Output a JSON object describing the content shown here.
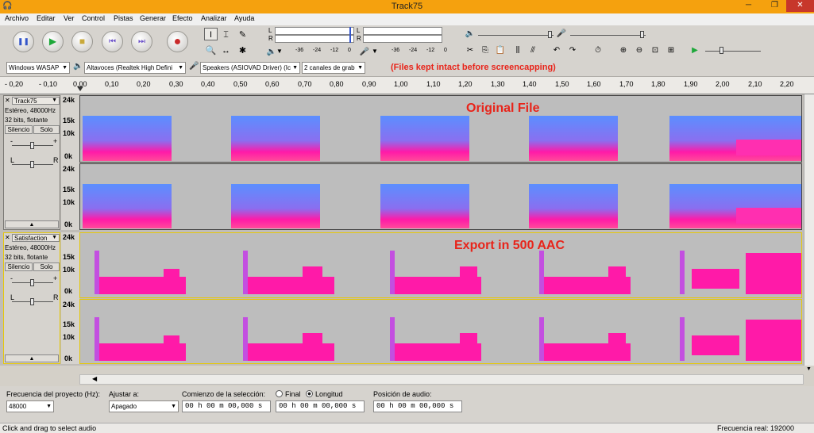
{
  "window": {
    "title": "Track75",
    "min": "─",
    "max": "❐",
    "close": "✕"
  },
  "menu": [
    "Archivo",
    "Editar",
    "Ver",
    "Control",
    "Pistas",
    "Generar",
    "Efecto",
    "Analizar",
    "Ayuda"
  ],
  "transport": {
    "pause": "❚❚",
    "play": "▶",
    "stop": "■",
    "skip_start": "⏮",
    "skip_end": "⏭",
    "record": "●"
  },
  "meters": {
    "rec_scale": [
      "-36",
      "-24",
      "-12",
      "0"
    ],
    "play_scale": [
      "-36",
      "-24",
      "-12",
      "0"
    ],
    "L": "L",
    "R": "R"
  },
  "devices": {
    "host": "Windows WASAP",
    "input": "Altavoces (Realtek High Defini",
    "output": "Speakers (ASIOVAD Driver) (Ic",
    "channels": "2 canales de grab"
  },
  "note": "(Files kept intact before screencapping)",
  "ruler": [
    "- 0,20",
    "- 0,10",
    "0,00",
    "0,10",
    "0,20",
    "0,30",
    "0,40",
    "0,50",
    "0,60",
    "0,70",
    "0,80",
    "0,90",
    "1,00",
    "1,10",
    "1,20",
    "1,30",
    "1,40",
    "1,50",
    "1,60",
    "1,70",
    "1,80",
    "1,90",
    "2,00",
    "2,10",
    "2,20"
  ],
  "tracks": [
    {
      "name": "Track75",
      "info1": "Estéreo, 48000Hz",
      "info2": "32 bits, flotante",
      "mute": "Silencio",
      "solo": "Solo",
      "label": "Original File",
      "scale": [
        "24k",
        "15k",
        "10k",
        "0k"
      ],
      "gain_minus": "-",
      "gain_plus": "+",
      "pan_l": "L",
      "pan_r": "R"
    },
    {
      "name": "Satisfaction",
      "info1": "Estéreo, 48000Hz",
      "info2": "32 bits, flotante",
      "mute": "Silencio",
      "solo": "Solo",
      "label": "Export in 500 AAC",
      "scale": [
        "24k",
        "15k",
        "10k",
        "0k"
      ],
      "gain_minus": "-",
      "gain_plus": "+",
      "pan_l": "L",
      "pan_r": "R"
    }
  ],
  "bottom": {
    "rate_label": "Frecuencia del proyecto (Hz):",
    "rate_value": "48000",
    "snap_label": "Ajustar a:",
    "snap_value": "Apagado",
    "sel_label": "Comienzo de la selección:",
    "opt_end": "Final",
    "opt_len": "Longitud",
    "sel_start": "00 h 00 m 00,000 s",
    "sel_len": "00 h 00 m 00,000 s",
    "pos_label": "Posición de audio:",
    "pos_value": "00 h 00 m 00,000 s"
  },
  "status": {
    "left": "Click and drag to select audio",
    "right": "Frecuencia real: 192000"
  },
  "colors": {
    "accent": "#f5a10e",
    "spectrum_hot": "#ff1aa8",
    "spectrum_cool": "#5b8fff",
    "label_red": "#e8241a"
  }
}
